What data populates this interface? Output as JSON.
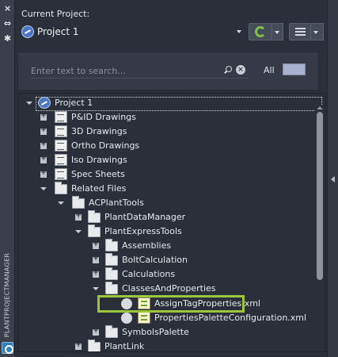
{
  "side_strip": {
    "label": "PLANTPROJECTMANAGER",
    "buttons": [
      "×",
      "⇔",
      "✱"
    ]
  },
  "header": {
    "current_project_label": "Current Project:",
    "project_name": "Project 1"
  },
  "search": {
    "placeholder": "Enter text to search...",
    "filter_label": "All"
  },
  "tree": {
    "rows": [
      {
        "label": "Project 1",
        "icon": "globe-icon"
      },
      {
        "label": "P&ID Drawings",
        "icon": "document-icon"
      },
      {
        "label": "3D Drawings",
        "icon": "document-icon"
      },
      {
        "label": "Ortho Drawings",
        "icon": "document-icon"
      },
      {
        "label": "Iso Drawings",
        "icon": "document-icon"
      },
      {
        "label": "Spec Sheets",
        "icon": "document-icon"
      },
      {
        "label": "Related Files",
        "icon": "folder-icon"
      },
      {
        "label": "ACPlantTools",
        "icon": "folder-icon"
      },
      {
        "label": "PlantDataManager",
        "icon": "folder-icon"
      },
      {
        "label": "PlantExpressTools",
        "icon": "folder-icon"
      },
      {
        "label": "Assemblies",
        "icon": "folder-icon"
      },
      {
        "label": "BoltCalculation",
        "icon": "folder-icon"
      },
      {
        "label": "Calculations",
        "icon": "folder-icon"
      },
      {
        "label": "ClassesAndProperties",
        "icon": "folder-icon"
      },
      {
        "label": "AssignTagProperties.xml",
        "icon": "xml-file-icon"
      },
      {
        "label": "PropertiesPaletteConfiguration.xml",
        "icon": "xml-file-icon"
      },
      {
        "label": "SymbolsPalette",
        "icon": "folder-icon"
      },
      {
        "label": "PlantLink",
        "icon": "folder-icon"
      }
    ]
  },
  "colors": {
    "highlight": "#9bc53d",
    "background": "#2b2f3a",
    "panel": "#353a46"
  }
}
